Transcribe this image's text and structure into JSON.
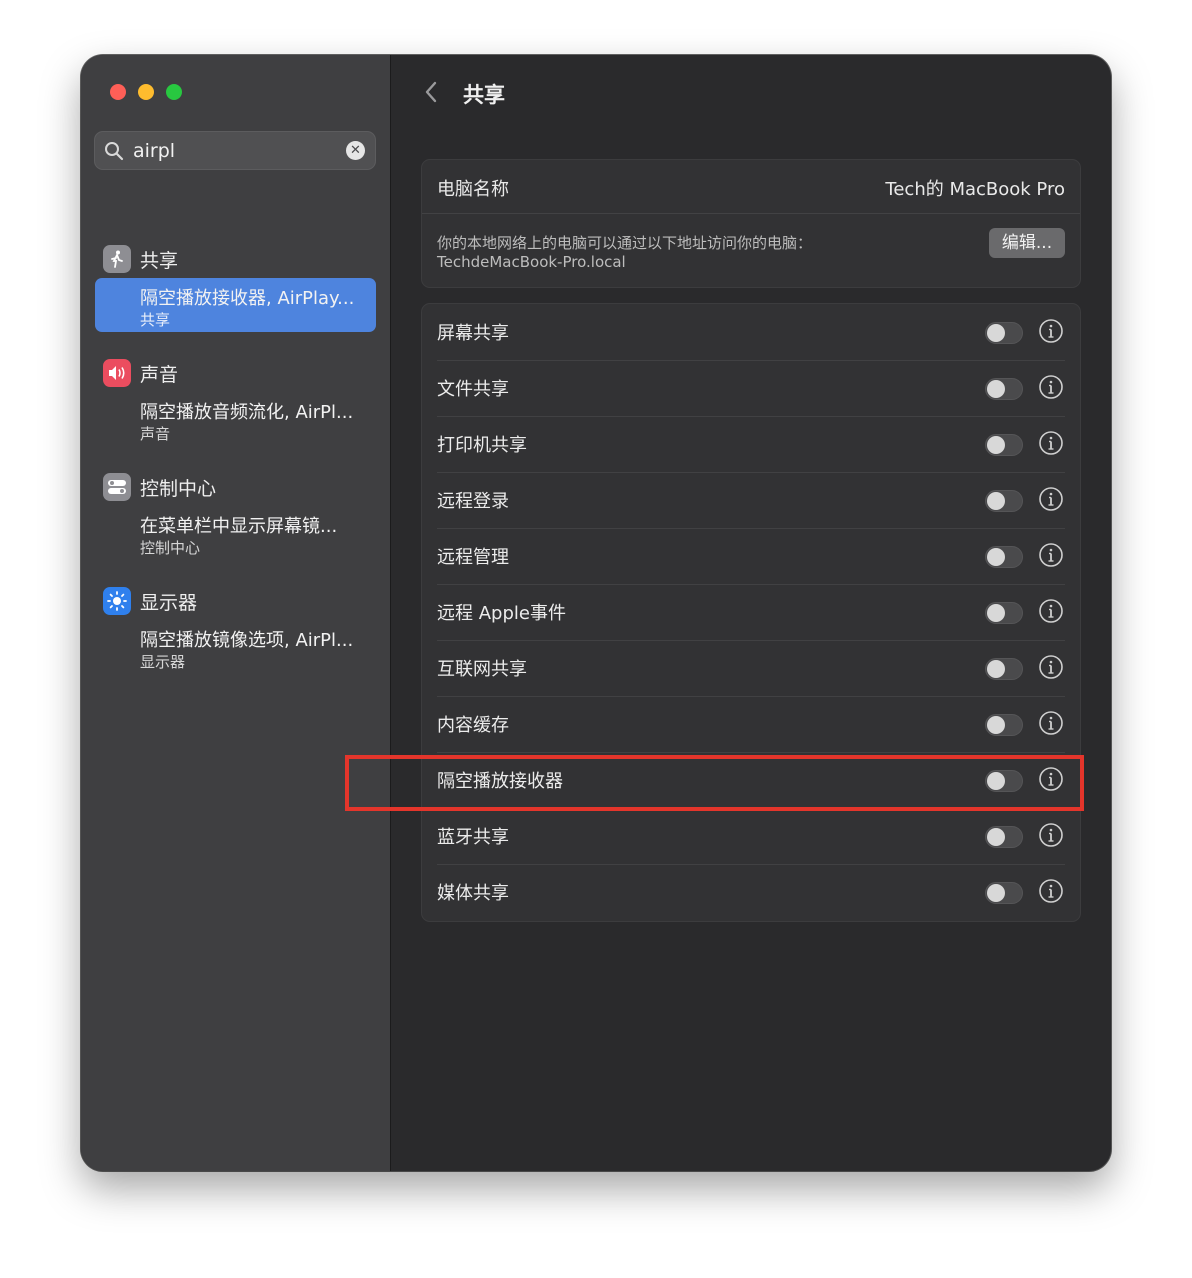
{
  "search": {
    "value": "airpl"
  },
  "sidebar": {
    "groups": [
      {
        "title": "共享",
        "result": "隔空播放接收器, AirPlay...",
        "category": "共享",
        "selected": true,
        "icon": "sharing-icon",
        "color": "#8e8e93"
      },
      {
        "title": "声音",
        "result": "隔空播放音频流化, AirPl...",
        "category": "声音",
        "selected": false,
        "icon": "speaker-icon",
        "color": "#eb4d5f"
      },
      {
        "title": "控制中心",
        "result": "在菜单栏中显示屏幕镜...",
        "category": "控制中心",
        "selected": false,
        "icon": "control-center-icon",
        "color": "#8e8e93"
      },
      {
        "title": "显示器",
        "result": "隔空播放镜像选项, AirPl...",
        "category": "显示器",
        "selected": false,
        "icon": "display-brightness-icon",
        "color": "#2f80ed"
      }
    ]
  },
  "main": {
    "title": "共享",
    "computer_name_label": "电脑名称",
    "computer_name": "Tech的 MacBook Pro",
    "address_desc": "你的本地网络上的电脑可以通过以下地址访问你的电脑：",
    "address": "TechdeMacBook-Pro.local",
    "edit_label": "编辑...",
    "services": [
      {
        "label": "屏幕共享",
        "on": false
      },
      {
        "label": "文件共享",
        "on": false
      },
      {
        "label": "打印机共享",
        "on": false
      },
      {
        "label": "远程登录",
        "on": false
      },
      {
        "label": "远程管理",
        "on": false
      },
      {
        "label": "远程 Apple事件",
        "on": false
      },
      {
        "label": "互联网共享",
        "on": false
      },
      {
        "label": "内容缓存",
        "on": false
      },
      {
        "label": "隔空播放接收器",
        "on": false
      },
      {
        "label": "蓝牙共享",
        "on": false
      },
      {
        "label": "媒体共享",
        "on": false
      }
    ]
  },
  "colors": {
    "accent": "#4e84de",
    "highlight": "#e4352b"
  }
}
